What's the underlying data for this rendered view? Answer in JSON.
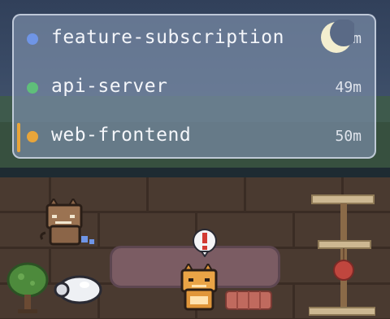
{
  "sessions": [
    {
      "name": "feature-subscription",
      "time": "<1m",
      "color": "#6f95e6",
      "active": false
    },
    {
      "name": "api-server",
      "time": "49m",
      "color": "#5fbf7a",
      "active": false
    },
    {
      "name": "web-frontend",
      "time": "50m",
      "color": "#e8a53a",
      "active": true
    }
  ],
  "icons": {
    "moon": "moon-icon",
    "alert": "exclamation-bubble-icon"
  },
  "colors": {
    "active_bar": "#e8a53a",
    "panel_border": "#dce4f0"
  }
}
